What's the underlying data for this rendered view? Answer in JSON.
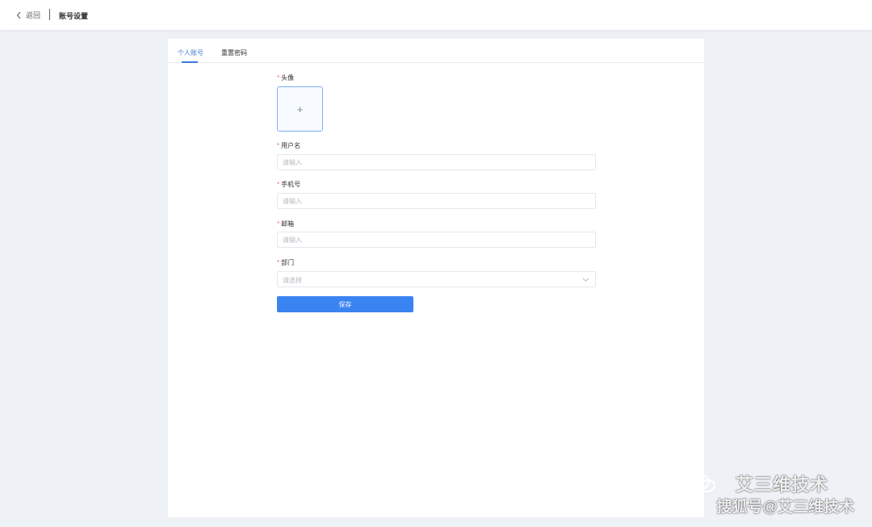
{
  "header": {
    "back_label": "返回",
    "title": "账号设置"
  },
  "tabs": [
    {
      "label": "个人账号",
      "active": true
    },
    {
      "label": "重置密码",
      "active": false
    }
  ],
  "form": {
    "avatar": {
      "label": "头像",
      "required": true,
      "upload_icon": "+"
    },
    "username": {
      "label": "用户名",
      "required": true,
      "placeholder": "请输入",
      "value": ""
    },
    "phone": {
      "label": "手机号",
      "required": true,
      "placeholder": "请输入",
      "value": ""
    },
    "email": {
      "label": "邮箱",
      "required": true,
      "placeholder": "请输入",
      "value": ""
    },
    "department": {
      "label": "部门",
      "required": true,
      "placeholder": "请选择"
    },
    "save_label": "保存"
  },
  "watermark": {
    "line1": "艾三维技术",
    "line2": "搜狐号@艾三维技术"
  },
  "colors": {
    "accent": "#3a7bd5",
    "button": "#3a84f1",
    "required": "#f56c6c",
    "background": "#eef1f6"
  }
}
